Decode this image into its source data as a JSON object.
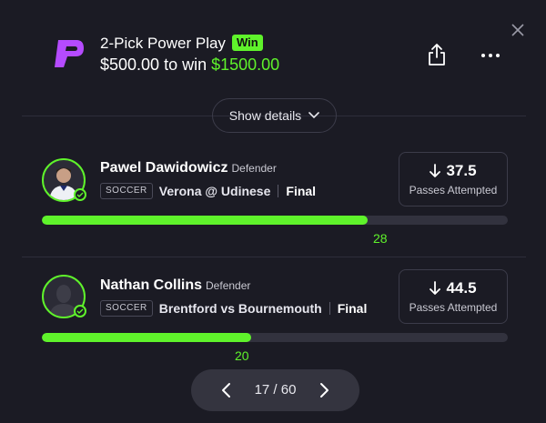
{
  "header": {
    "title": "2-Pick Power Play",
    "result_badge": "Win",
    "entry_amount": "$500.00 to win",
    "payout_amount": "$1500.00",
    "accent_color": "#5ff32b"
  },
  "show_details_label": "Show details",
  "picks": [
    {
      "player_name": "Pawel Dawidowicz",
      "position": "Defender",
      "sport": "SOCCER",
      "matchup": "Verona @ Udinese",
      "status": "Final",
      "direction": "arrow-down-icon",
      "line": "37.5",
      "stat": "Passes Attempted",
      "actual": "28",
      "progress_fraction": 0.7
    },
    {
      "player_name": "Nathan Collins",
      "position": "Defender",
      "sport": "SOCCER",
      "matchup": "Brentford vs Bournemouth",
      "status": "Final",
      "direction": "arrow-down-icon",
      "line": "44.5",
      "stat": "Passes Attempted",
      "actual": "20",
      "progress_fraction": 0.45
    }
  ],
  "pagination": {
    "text": "17 / 60"
  }
}
